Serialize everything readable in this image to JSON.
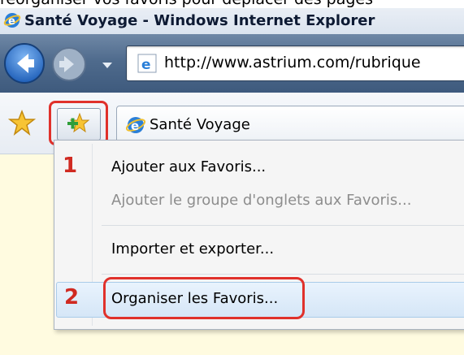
{
  "caption": "réorganiser vos favoris pour déplacer des pages",
  "window": {
    "title": "Santé Voyage - Windows Internet Explorer"
  },
  "address": {
    "url": "http://www.astrium.com/rubrique"
  },
  "tab": {
    "label": "Santé Voyage"
  },
  "menu": {
    "items": [
      {
        "label": "Ajouter aux Favoris...",
        "enabled": true
      },
      {
        "label": "Ajouter le groupe d'onglets aux Favoris...",
        "enabled": false
      },
      {
        "label": "Importer et exporter...",
        "enabled": true
      },
      {
        "label": "Organiser les Favoris...",
        "enabled": true,
        "highlighted": true
      }
    ]
  },
  "annotations": {
    "step1": "1",
    "step2": "2"
  },
  "colors": {
    "annotation_red": "#e0312b",
    "navbar_blue": "#4f6b8d",
    "page_bg": "#fffbe0"
  },
  "icons": {
    "title": "ie-logo-icon",
    "back": "back-arrow-icon",
    "forward": "forward-arrow-icon",
    "favorites_center": "favorites-star-icon",
    "add_favorite": "add-favorite-icon"
  }
}
